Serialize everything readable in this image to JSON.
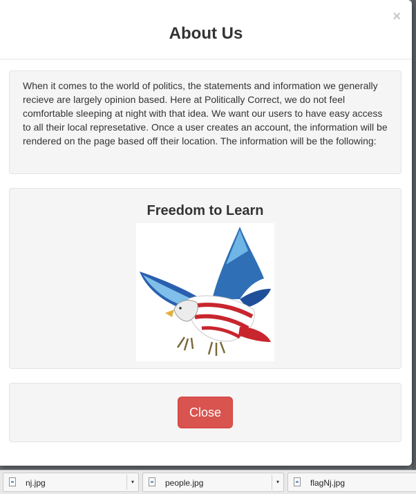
{
  "modal": {
    "title": "About Us",
    "close_symbol": "×",
    "intro_text": "When it comes to the world of politics, the statements and information we generally recieve are largely opinion based. Here at Politically Correct, we do not feel comfortable sleeping at night with that idea. We want our users to have easy access to all their local represetative. Once a user creates an account, the information will be rendered on the page based off their location. The information will be the following:",
    "feature": {
      "title": "Freedom to Learn",
      "image": "eagle-flag-illustration"
    },
    "close_button_label": "Close"
  },
  "colors": {
    "close_button": "#d9534f",
    "well_background": "#f5f5f5",
    "text": "#333333"
  },
  "download_bar": {
    "items": [
      {
        "filename": "nj.jpg",
        "icon": "file-icon",
        "arrow": "▾"
      },
      {
        "filename": "people.jpg",
        "icon": "file-icon",
        "arrow": "▾"
      },
      {
        "filename": "flagNj.jpg",
        "icon": "file-icon",
        "arrow": ""
      }
    ]
  }
}
